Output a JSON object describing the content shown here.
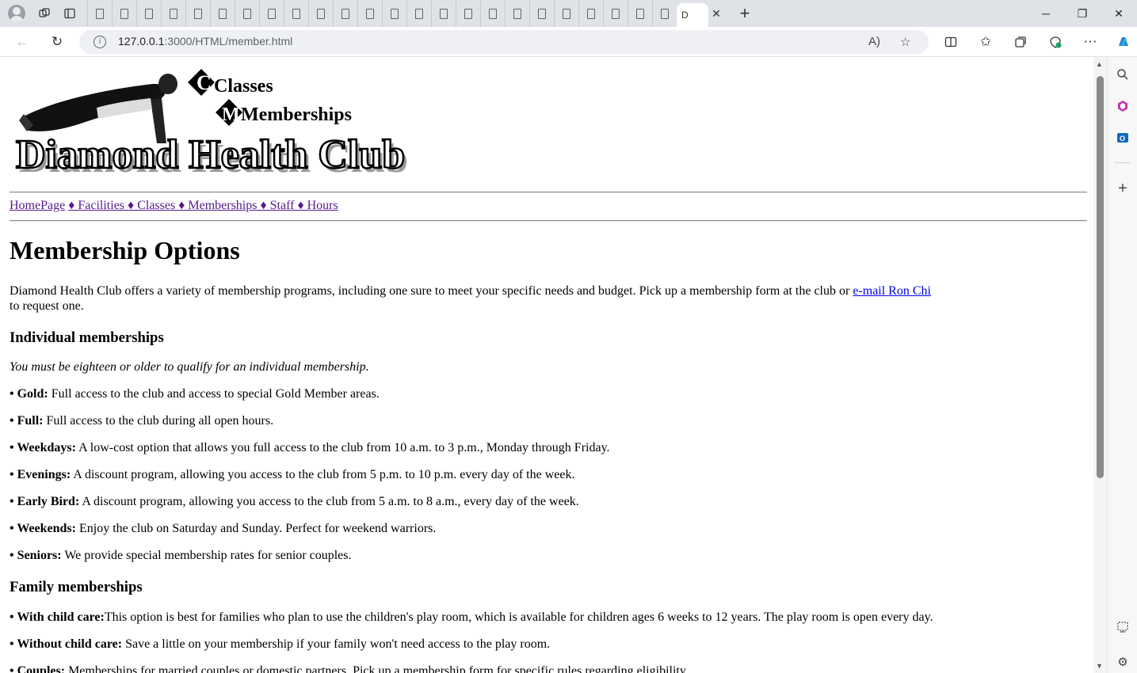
{
  "browser": {
    "url_host": "127.0.0.1",
    "url_path": ":3000/HTML/member.html",
    "active_tab_label": "D",
    "mini_tab_count": 24
  },
  "banner": {
    "line1": "Classes",
    "line2": "Memberships",
    "title": "Diamond Health Club"
  },
  "nav": {
    "links": [
      "HomePage",
      "♦ Facilities ",
      "♦ Classes ",
      "♦ Memberships ",
      "♦ Staff ",
      "♦ Hours"
    ]
  },
  "page": {
    "heading": "Membership Options",
    "intro_text": "Diamond Health Club offers a variety of membership programs, including one sure to meet your specific needs and budget. Pick up a membership form at the club or ",
    "intro_link": "e-mail Ron Chi",
    "intro_end": "to request one.",
    "individual_heading": "Individual memberships",
    "individual_note": "You must be eighteen or older to qualify for an individual membership.",
    "individual_items": [
      {
        "name": "• Gold:",
        "desc": " Full access to the club and access to special Gold Member areas."
      },
      {
        "name": "• Full:",
        "desc": " Full access to the club during all open hours."
      },
      {
        "name": "• Weekdays:",
        "desc": " A low-cost option that allows you full access to the club from 10 a.m. to 3 p.m., Monday through Friday."
      },
      {
        "name": "• Evenings:",
        "desc": " A discount program, allowing you access to the club from 5 p.m. to 10 p.m. every day of the week."
      },
      {
        "name": "• Early Bird:",
        "desc": " A discount program, allowing you access to the club from 5 a.m. to 8 a.m., every day of the week."
      },
      {
        "name": "• Weekends:",
        "desc": " Enjoy the club on Saturday and Sunday. Perfect for weekend warriors."
      },
      {
        "name": "• Seniors:",
        "desc": " We provide special membership rates for senior couples."
      }
    ],
    "family_heading": "Family memberships",
    "family_items": [
      {
        "name": "• With child care:",
        "desc": "This option is best for families who plan to use the children's play room, which is available for children ages 6 weeks to 12 years. The play room is open every day."
      },
      {
        "name": "• Without child care:",
        "desc": " Save a little on your membership if your family won't need access to the play room."
      },
      {
        "name": "• Couples:",
        "desc": " Memberships for married couples or domestic partners. Pick up a membership form for specific rules regarding eligibility."
      }
    ]
  }
}
